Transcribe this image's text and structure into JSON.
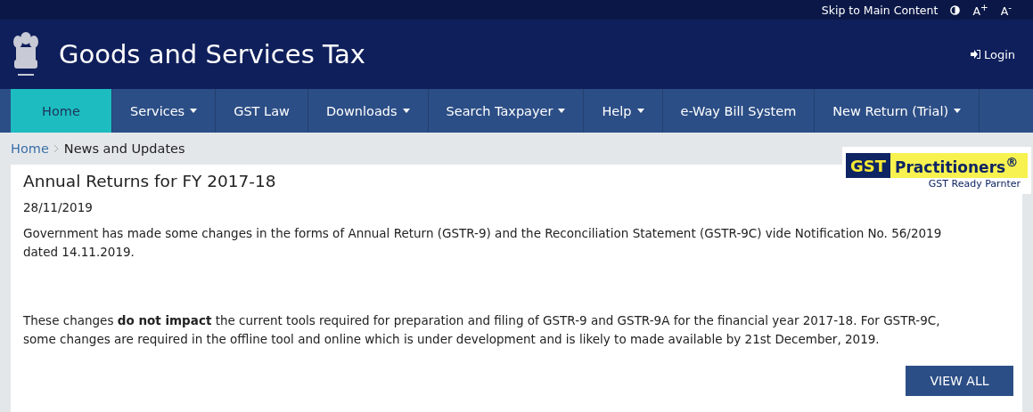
{
  "utility_bar": {
    "skip_link": "Skip to Main Content",
    "font_increase": "A",
    "font_increase_mark": "+",
    "font_decrease": "A",
    "font_decrease_mark": "-"
  },
  "header": {
    "title": "Goods and Services Tax",
    "login": "Login"
  },
  "nav": [
    {
      "label": "Home",
      "selected": true,
      "dropdown": false
    },
    {
      "label": "Services",
      "selected": false,
      "dropdown": true
    },
    {
      "label": "GST Law",
      "selected": false,
      "dropdown": false
    },
    {
      "label": "Downloads",
      "selected": false,
      "dropdown": true
    },
    {
      "label": "Search Taxpayer",
      "selected": false,
      "dropdown": true
    },
    {
      "label": "Help",
      "selected": false,
      "dropdown": true
    },
    {
      "label": "e-Way Bill System",
      "selected": false,
      "dropdown": false
    },
    {
      "label": "New Return (Trial)",
      "selected": false,
      "dropdown": true
    }
  ],
  "breadcrumb": [
    {
      "label": "Home",
      "kind": "link"
    },
    {
      "label": "News and Updates",
      "kind": "current"
    }
  ],
  "ad": {
    "tag": "GST",
    "brand": "Practitioners$^{®}$",
    "tagline": "GST Ready Parnter"
  },
  "article": {
    "title": "Annual Returns for FY 2017-18",
    "date": "28/11/2019",
    "paragraphs": [
      "Government has made some changes in the forms of Annual Return (GSTR-9) and the Reconciliation Statement (GSTR-9C) vide Notification No. 56/2019 dated 14.11.2019.",
      "These changes **do not impact** the current tools required for preparation and filing of GSTR-9 and GSTR-9A for the financial year 2017-18. For GSTR-9C, some changes are required in the offline tool and online which is under development and is likely to made available by 21st December, 2019."
    ],
    "button": "VIEW ALL"
  }
}
